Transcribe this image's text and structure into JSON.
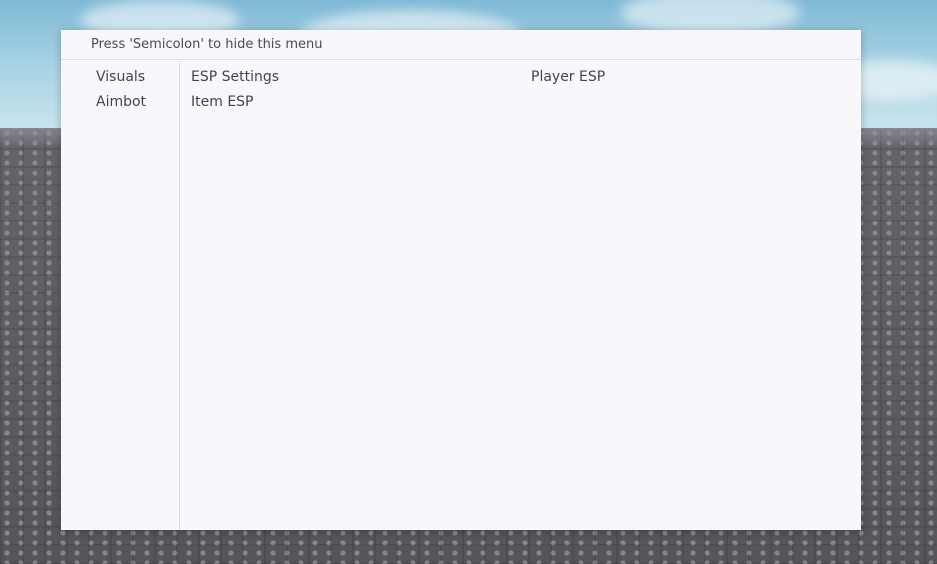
{
  "menu": {
    "hint": "Press 'Semicolon' to hide this menu"
  },
  "sidebar": {
    "items": [
      {
        "label": "Visuals"
      },
      {
        "label": "Aimbot"
      }
    ]
  },
  "content": {
    "column_left": [
      {
        "label": "ESP Settings"
      },
      {
        "label": "Item ESP"
      }
    ],
    "column_right": [
      {
        "label": "Player ESP"
      }
    ]
  },
  "colors": {
    "menu_background": "#f7f7fc",
    "divider": "#dcdce4",
    "text": "#44444f",
    "sky": "#a9d3e4",
    "ground": "#6b6870"
  }
}
